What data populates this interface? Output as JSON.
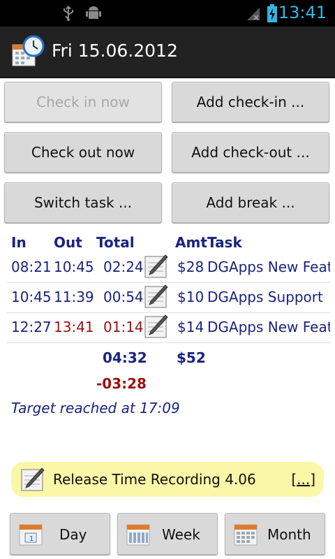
{
  "status": {
    "time": "13:41",
    "colors": {
      "accent": "#33b5e5"
    }
  },
  "header": {
    "title": "Fri 15.06.2012",
    "icon": "calendar-clock-icon"
  },
  "buttons": {
    "check_in_now": "Check in now",
    "add_check_in": "Add check-in ...",
    "check_out_now": "Check out now",
    "add_check_out": "Add check-out ...",
    "switch_task": "Switch task ...",
    "add_break": "Add break ..."
  },
  "table": {
    "headers": {
      "in": "In",
      "out": "Out",
      "total": "Total",
      "amt": "Amt",
      "task": "Task"
    },
    "rows": [
      {
        "in": "08:21",
        "out": "10:45",
        "total": "02:24",
        "amt": "$28",
        "task": "DGApps New Features"
      },
      {
        "in": "10:45",
        "out": "11:39",
        "total": "00:54",
        "amt": "$10",
        "task": "DGApps Support"
      },
      {
        "in": "12:27",
        "out": "13:41",
        "total": "01:14",
        "amt": "$14",
        "task": "DGApps New Features"
      }
    ],
    "sum_total": "04:32",
    "sum_amt": "$52",
    "balance": "-03:28",
    "target": "Target reached at 17:09"
  },
  "notice": {
    "text": "Release Time Recording 4.06",
    "link": "[...]"
  },
  "nav": {
    "day": "Day",
    "week": "Week",
    "month": "Month"
  },
  "colors": {
    "text_blue": "#1a237e",
    "text_red": "#9b1010",
    "notice_bg": "#fbf7a8"
  }
}
